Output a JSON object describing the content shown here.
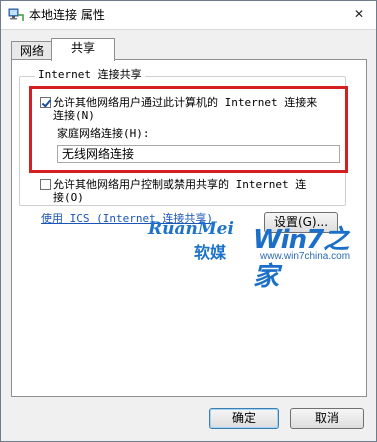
{
  "window": {
    "title": "本地连接 属性",
    "close_glyph": "✕"
  },
  "tabs": [
    {
      "label": "网络",
      "active": false
    },
    {
      "label": "共享",
      "active": true
    }
  ],
  "group": {
    "legend": "Internet 连接共享",
    "allow_share": {
      "checked": true,
      "label_line1": "允许其他网络用户通过此计算机的 Internet 连接来",
      "label_line2": "连接(N)"
    },
    "home_network": {
      "label": "家庭网络连接(H):",
      "value": "无线网络连接"
    },
    "allow_control": {
      "checked": false,
      "label_line1": "允许其他网络用户控制或禁用共享的 Internet 连",
      "label_line2": "接(O)"
    }
  },
  "link": "使用 ICS (Internet 连接共享)",
  "settings_button": "设置(G)...",
  "watermark": {
    "brand_latin": "RuanMei",
    "brand_cn": "软媒",
    "win7": "Win7之家",
    "url": "www.win7china.com"
  },
  "footer": {
    "ok": "确定",
    "cancel": "取消"
  },
  "colors": {
    "highlight_border": "#d42020",
    "link": "#1a55b8",
    "brand_blue": "#1d73c9"
  },
  "icons": {
    "title": "network-connection-icon",
    "close": "close-icon"
  }
}
